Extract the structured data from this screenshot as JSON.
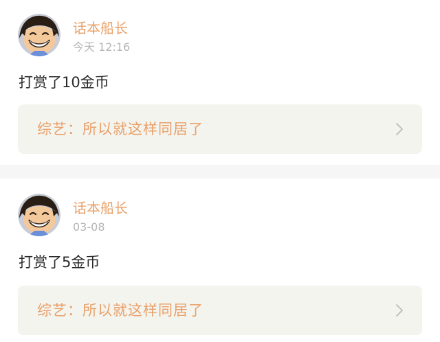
{
  "feed": {
    "items": [
      {
        "username": "话本船长",
        "time": "今天 12:16",
        "message": "打赏了10金币",
        "source": "综艺：所以就这样同居了",
        "avatar_icon": "cartoon-avatar-icon",
        "chevron_icon": "chevron-right-icon"
      },
      {
        "username": "话本船长",
        "time": "03-08",
        "message": "打赏了5金币",
        "source": "综艺：所以就这样同居了",
        "avatar_icon": "cartoon-avatar-icon",
        "chevron_icon": "chevron-right-icon"
      }
    ]
  },
  "colors": {
    "accent": "#e8a069",
    "timestamp": "#b5b5b5",
    "text": "#2b2b2b",
    "source_bg": "#f4f4ee",
    "divider": "#f6f6f6"
  }
}
